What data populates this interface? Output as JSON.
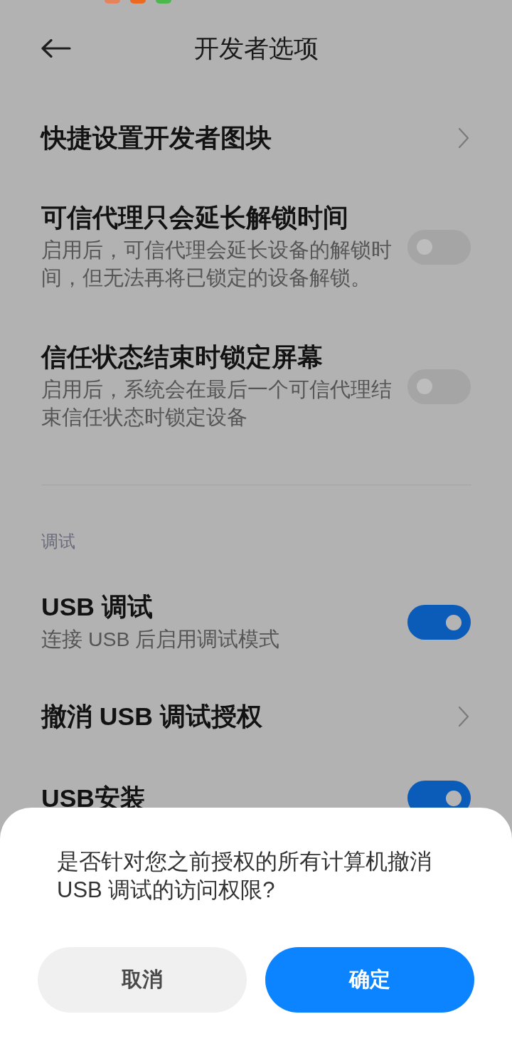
{
  "status_bar": {
    "notification_icons": [
      {
        "color": "#e5835c"
      },
      {
        "color": "#ec6920"
      },
      {
        "color": "#4cb74a"
      }
    ]
  },
  "header": {
    "title": "开发者选项"
  },
  "sections": [
    {
      "items": [
        {
          "kind": "link",
          "title": "快捷设置开发者图块"
        },
        {
          "kind": "toggle",
          "title": "可信代理只会延长解锁时间",
          "subtitle": "启用后，可信代理会延长设备的解锁时间，但无法再将已锁定的设备解锁。",
          "on": false
        },
        {
          "kind": "toggle",
          "title": "信任状态结束时锁定屏幕",
          "subtitle": "启用后，系统会在最后一个可信代理结束信任状态时锁定设备",
          "on": false
        }
      ]
    },
    {
      "header": "调试",
      "items": [
        {
          "kind": "toggle",
          "title": "USB 调试",
          "subtitle": "连接 USB 后启用调试模式",
          "on": true
        },
        {
          "kind": "link",
          "title": "撤消 USB 调试授权"
        },
        {
          "kind": "toggle",
          "title": "USB安装",
          "on": true
        }
      ]
    }
  ],
  "dialog": {
    "message": "是否针对您之前授权的所有计算机撤消 USB 调试的访问权限?",
    "buttons": [
      {
        "kind": "secondary",
        "label": "取消"
      },
      {
        "kind": "primary",
        "label": "确定"
      }
    ]
  }
}
